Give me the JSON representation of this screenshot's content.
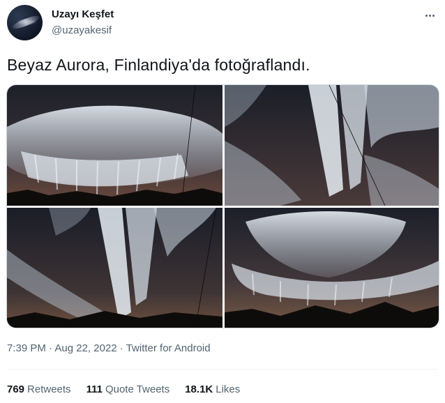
{
  "author": {
    "name": "Uzayı Keşfet",
    "handle": "@uzayakesif"
  },
  "tweet": {
    "text": "Beyaz Aurora, Finlandiya'da fotoğraflandı."
  },
  "meta": {
    "time": "7:39 PM",
    "separator": " · ",
    "date": "Aug 22, 2022",
    "source": "Twitter for Android"
  },
  "stats": {
    "retweets_count": "769",
    "retweets_label": "Retweets",
    "quotes_count": "111",
    "quotes_label": "Quote Tweets",
    "likes_count": "18.1K",
    "likes_label": "Likes"
  },
  "colors": {
    "primary_text": "#0f1419",
    "secondary_text": "#536471",
    "divider": "#eff3f4"
  }
}
